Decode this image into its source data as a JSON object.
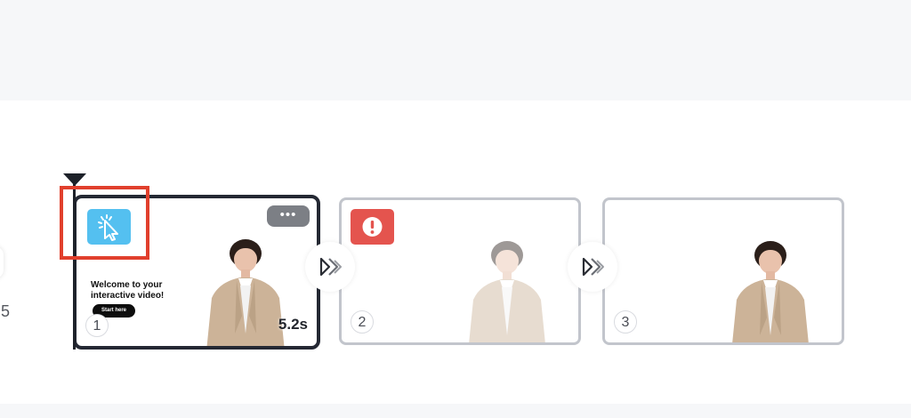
{
  "timeline": {
    "side_label": "5",
    "scenes": [
      {
        "number": "1",
        "duration": "5.2s",
        "overlay_text": "Welcome to your interactive video!",
        "overlay_button": "Start here",
        "badge": "cursor-click-icon",
        "active": true
      },
      {
        "number": "2",
        "badge": "warning-icon",
        "active": false
      },
      {
        "number": "3",
        "active": false
      }
    ],
    "more_label": "•••",
    "transition_icon": "double-chevron-right-icon"
  },
  "colors": {
    "active_border": "#242833",
    "inactive_border": "#c2c5cc",
    "interact_badge": "#54c0f0",
    "warning_badge": "#e4544e",
    "highlight": "#e1402d"
  }
}
